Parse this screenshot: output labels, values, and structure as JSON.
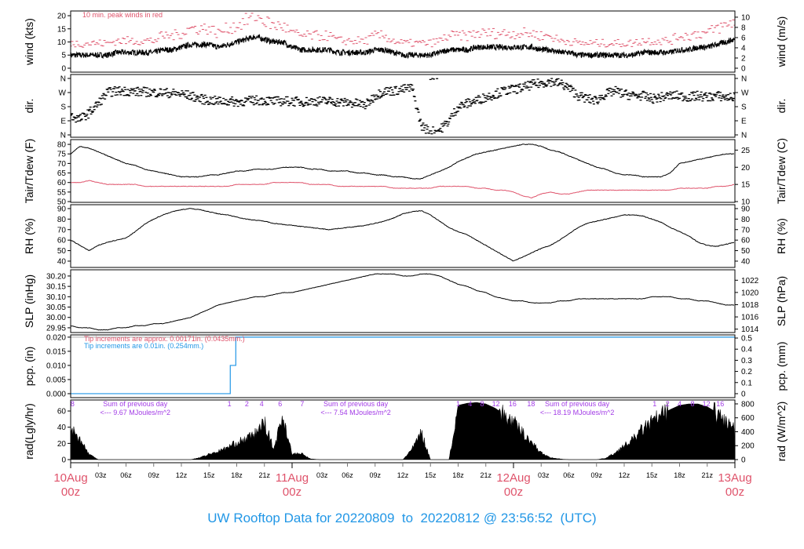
{
  "title": "UW Rooftop Data for 20220809  to  20220812 @ 23:56:52  (UTC)",
  "colors": {
    "peak": "#DF536B",
    "dew": "#DF536B",
    "pcp": "#2297E6",
    "note_red": "#DF536B",
    "note_blue": "#2297E6",
    "purple": "#A23BE6",
    "date": "#DF536B",
    "title": "#2297E6"
  },
  "x_axis": {
    "hours": [
      0,
      72
    ],
    "major": [
      {
        "hour": 0,
        "day": "10Aug",
        "time": "00z"
      },
      {
        "hour": 24,
        "day": "11Aug",
        "time": "00z"
      },
      {
        "hour": 48,
        "day": "12Aug",
        "time": "00z"
      },
      {
        "hour": 72,
        "day": "13Aug",
        "time": "00z"
      }
    ],
    "minor": [
      "03z",
      "06z",
      "09z",
      "12z",
      "15z",
      "18z",
      "21z"
    ]
  },
  "chart_data": [
    {
      "id": "wind",
      "type": "line",
      "ylabel_left": "wind (kts)",
      "ylabel_right": "wind (m/s)",
      "ylim": [
        -1.5,
        21.8
      ],
      "left_ticks": [
        {
          "label": "0",
          "value": 0
        },
        {
          "label": "5",
          "value": 5
        },
        {
          "label": "10",
          "value": 10
        },
        {
          "label": "15",
          "value": 15
        },
        {
          "label": "20",
          "value": 20
        }
      ],
      "right_ticks": [
        {
          "label": "0",
          "value": 0
        },
        {
          "label": "2",
          "value": 2
        },
        {
          "label": "4",
          "value": 4
        },
        {
          "label": "6",
          "value": 6
        },
        {
          "label": "8",
          "value": 8
        },
        {
          "label": "10",
          "value": 10
        }
      ],
      "annotation": "10 min. peak winds in red",
      "series": [
        {
          "name": "wind_mean_kts",
          "values": [
            5,
            5,
            5,
            5,
            5,
            6,
            6,
            6,
            6,
            6,
            7,
            7,
            8,
            9,
            9,
            9,
            8,
            9,
            10,
            11,
            12,
            11,
            10,
            10,
            8,
            7,
            7,
            7,
            7,
            6,
            6,
            6,
            6,
            7,
            7,
            6,
            5,
            5,
            5,
            5,
            6,
            7,
            7,
            7,
            8,
            8,
            8,
            8,
            8,
            8,
            8,
            7,
            7,
            6,
            6,
            5,
            5,
            5,
            5,
            5,
            5,
            5,
            6,
            6,
            6,
            6,
            7,
            7,
            8,
            8,
            9,
            10,
            11
          ]
        },
        {
          "name": "wind_peak_10min_kts",
          "values": [
            10,
            10,
            10,
            10,
            10,
            11,
            11,
            11,
            11,
            11,
            13,
            13,
            14,
            16,
            16,
            16,
            14,
            16,
            17,
            19,
            21,
            19,
            17,
            17,
            14,
            13,
            13,
            13,
            13,
            11,
            11,
            11,
            11,
            13,
            13,
            11,
            10,
            10,
            10,
            10,
            11,
            13,
            13,
            13,
            14,
            14,
            14,
            14,
            14,
            14,
            14,
            13,
            13,
            11,
            11,
            10,
            10,
            10,
            10,
            10,
            10,
            10,
            11,
            11,
            11,
            11,
            13,
            13,
            14,
            14,
            16,
            17,
            19
          ]
        }
      ]
    },
    {
      "id": "dir",
      "type": "scatter",
      "ylabel_left": "dir.",
      "ylabel_right": "dir.",
      "ylim": [
        -15,
        385
      ],
      "left_ticks": [
        {
          "label": "N",
          "value": 0
        },
        {
          "label": "E",
          "value": 90
        },
        {
          "label": "S",
          "value": 180
        },
        {
          "label": "W",
          "value": 270
        },
        {
          "label": "N",
          "value": 360
        }
      ],
      "right_ticks": [
        {
          "label": "N",
          "value": 0
        },
        {
          "label": "E",
          "value": 90
        },
        {
          "label": "S",
          "value": 180
        },
        {
          "label": "W",
          "value": 270
        },
        {
          "label": "N",
          "value": 360
        }
      ],
      "series": [
        {
          "name": "wind_direction_deg",
          "values": [
            120,
            100,
            140,
            200,
            270,
            280,
            280,
            275,
            275,
            270,
            270,
            265,
            260,
            250,
            230,
            220,
            215,
            215,
            210,
            215,
            220,
            220,
            215,
            215,
            215,
            210,
            215,
            215,
            215,
            210,
            205,
            200,
            190,
            250,
            280,
            280,
            290,
            300,
            60,
            20,
            30,
            90,
            180,
            200,
            220,
            240,
            260,
            280,
            290,
            300,
            320,
            330,
            340,
            330,
            300,
            250,
            230,
            220,
            260,
            280,
            260,
            250,
            250,
            230,
            240,
            250,
            250,
            240,
            250,
            240,
            250,
            240,
            240
          ]
        }
      ]
    },
    {
      "id": "temp",
      "type": "line",
      "ylabel_left": "Tair/Tdew (F)",
      "ylabel_right": "Tair/Tdew (C)",
      "ylim": [
        49.6,
        82.5
      ],
      "left_ticks": [
        {
          "label": "50",
          "value": 50
        },
        {
          "label": "55",
          "value": 55
        },
        {
          "label": "60",
          "value": 60
        },
        {
          "label": "65",
          "value": 65
        },
        {
          "label": "70",
          "value": 70
        },
        {
          "label": "75",
          "value": 75
        },
        {
          "label": "80",
          "value": 80
        }
      ],
      "right_ticks": [
        {
          "label": "10",
          "value": 10
        },
        {
          "label": "15",
          "value": 15
        },
        {
          "label": "20",
          "value": 20
        },
        {
          "label": "25",
          "value": 25
        }
      ],
      "series": [
        {
          "name": "Tair_F",
          "values": [
            75,
            79,
            78,
            76,
            74,
            72,
            70,
            69,
            67,
            66,
            65,
            64,
            63,
            63,
            63,
            64,
            64,
            65,
            66,
            66,
            67,
            67,
            67,
            68,
            68,
            68,
            67,
            67,
            66,
            66,
            66,
            65,
            65,
            64,
            64,
            63,
            63,
            62,
            62,
            64,
            66,
            68,
            71,
            73,
            75,
            76,
            77,
            78,
            79,
            80,
            80,
            79,
            77,
            76,
            74,
            72,
            70,
            68,
            67,
            65,
            64,
            64,
            63,
            63,
            63,
            65,
            70,
            71,
            72,
            73,
            74,
            75,
            75
          ]
        },
        {
          "name": "Tdew_F",
          "values": [
            60,
            60,
            61,
            60,
            59,
            59,
            59,
            59,
            58,
            58,
            58,
            58,
            58,
            58,
            58,
            58,
            58,
            58,
            59,
            59,
            59,
            59,
            60,
            60,
            60,
            60,
            59,
            59,
            59,
            58,
            58,
            58,
            58,
            58,
            58,
            57,
            57,
            57,
            57,
            57,
            58,
            58,
            58,
            58,
            57,
            57,
            56,
            56,
            55,
            53,
            52,
            54,
            55,
            54,
            54,
            55,
            56,
            56,
            56,
            56,
            56,
            56,
            56,
            56,
            56,
            56,
            57,
            57,
            57,
            57,
            58,
            58,
            59
          ]
        }
      ]
    },
    {
      "id": "rh",
      "type": "line",
      "ylabel_left": "RH (%)",
      "ylabel_right": "RH (%)",
      "ylim": [
        34,
        93.7
      ],
      "left_ticks": [
        {
          "label": "40",
          "value": 40
        },
        {
          "label": "50",
          "value": 50
        },
        {
          "label": "60",
          "value": 60
        },
        {
          "label": "70",
          "value": 70
        },
        {
          "label": "80",
          "value": 80
        },
        {
          "label": "90",
          "value": 90
        }
      ],
      "right_ticks": [
        {
          "label": "40",
          "value": 40
        },
        {
          "label": "50",
          "value": 50
        },
        {
          "label": "60",
          "value": 60
        },
        {
          "label": "70",
          "value": 70
        },
        {
          "label": "80",
          "value": 80
        },
        {
          "label": "90",
          "value": 90
        }
      ],
      "series": [
        {
          "name": "RH_pct",
          "values": [
            60,
            55,
            50,
            55,
            58,
            60,
            62,
            68,
            75,
            80,
            84,
            87,
            89,
            90,
            89,
            87,
            85,
            84,
            82,
            80,
            79,
            78,
            76,
            75,
            74,
            73,
            72,
            71,
            70,
            71,
            72,
            73,
            74,
            76,
            78,
            81,
            85,
            87,
            88,
            84,
            78,
            72,
            68,
            65,
            60,
            55,
            50,
            45,
            40,
            44,
            48,
            52,
            55,
            60,
            66,
            72,
            76,
            78,
            80,
            82,
            84,
            84,
            83,
            80,
            77,
            72,
            68,
            64,
            58,
            55,
            54,
            56,
            58
          ]
        }
      ]
    },
    {
      "id": "slp",
      "type": "line",
      "ylabel_left": "SLP (inHg)",
      "ylabel_right": "SLP (hPa)",
      "ylim": [
        29.927,
        30.23
      ],
      "left_ticks": [
        {
          "label": "29.95",
          "value": 29.95
        },
        {
          "label": "30.00",
          "value": 30.0
        },
        {
          "label": "30.05",
          "value": 30.05
        },
        {
          "label": "30.10",
          "value": 30.1
        },
        {
          "label": "30.15",
          "value": 30.15
        },
        {
          "label": "30.20",
          "value": 30.2
        }
      ],
      "right_ticks": [
        {
          "label": "1014",
          "value": 1014
        },
        {
          "label": "1016",
          "value": 1016
        },
        {
          "label": "1018",
          "value": 1018
        },
        {
          "label": "1020",
          "value": 1020
        },
        {
          "label": "1022",
          "value": 1022
        }
      ],
      "series": [
        {
          "name": "SLP_inHg",
          "values": [
            29.96,
            29.95,
            29.95,
            29.94,
            29.94,
            29.95,
            29.95,
            29.96,
            29.96,
            29.97,
            29.97,
            29.98,
            29.99,
            30.0,
            30.02,
            30.04,
            30.06,
            30.07,
            30.08,
            30.09,
            30.1,
            30.1,
            30.11,
            30.12,
            30.12,
            30.13,
            30.14,
            30.15,
            30.16,
            30.17,
            30.18,
            30.19,
            30.2,
            30.21,
            30.21,
            30.21,
            30.2,
            30.2,
            30.21,
            30.21,
            30.2,
            30.18,
            30.16,
            30.15,
            30.13,
            30.12,
            30.1,
            30.09,
            30.08,
            30.08,
            30.07,
            30.07,
            30.07,
            30.08,
            30.08,
            30.09,
            30.09,
            30.09,
            30.09,
            30.09,
            30.09,
            30.09,
            30.09,
            30.1,
            30.1,
            30.1,
            30.09,
            30.09,
            30.08,
            30.08,
            30.07,
            30.06,
            30.06
          ]
        }
      ]
    },
    {
      "id": "pcp",
      "type": "line",
      "ylabel_left": "pcp. (in)",
      "ylabel_right": "pcp. (mm)",
      "ylim": [
        -0.0014,
        0.0208
      ],
      "left_ticks": [
        {
          "label": "0.000",
          "value": 0
        },
        {
          "label": "0.005",
          "value": 0.005
        },
        {
          "label": "0.010",
          "value": 0.01
        },
        {
          "label": "0.015",
          "value": 0.015
        },
        {
          "label": "0.020",
          "value": 0.02
        }
      ],
      "right_ticks": [
        {
          "label": "0",
          "value": 0
        },
        {
          "label": "0.1",
          "value": 0.1
        },
        {
          "label": "0.2",
          "value": 0.2
        },
        {
          "label": "0.3",
          "value": 0.3
        },
        {
          "label": "0.4",
          "value": 0.4
        },
        {
          "label": "0.5",
          "value": 0.5
        }
      ],
      "note_red": "Tip increments are approx. 0.00171in. (0.0435mm.)",
      "note_blue": "Tip increments are 0.01in. (0.254mm.)",
      "series": [
        {
          "name": "accum_pcp_in",
          "x": [
            0,
            17.3,
            17.9,
            72
          ],
          "values": [
            0,
            0.01,
            0.02,
            0.02
          ]
        }
      ]
    },
    {
      "id": "rad",
      "type": "area",
      "ylabel_left": "rad(Lgly/hr)",
      "ylabel_right": "rad (W/m^2)",
      "ylim": [
        -45,
        856
      ],
      "left_ticks": [
        {
          "label": "0",
          "value": 0
        },
        {
          "label": "20",
          "value": 20
        },
        {
          "label": "40",
          "value": 40
        },
        {
          "label": "60",
          "value": 60
        }
      ],
      "right_ticks": [
        {
          "label": "0",
          "value": 0
        },
        {
          "label": "200",
          "value": 200
        },
        {
          "label": "400",
          "value": 400
        },
        {
          "label": "600",
          "value": 600
        },
        {
          "label": "800",
          "value": 800
        }
      ],
      "daily_sums": [
        {
          "label": "Sum of previous day",
          "value": "<--- 9.67 MJoules/m^2"
        },
        {
          "label": "Sum of previous day",
          "value": "<--- 7.54 MJoules/m^2"
        },
        {
          "label": "Sum of previous day",
          "value": "<--- 18.19 MJoules/m^2"
        }
      ],
      "marks": [
        "8",
        "1",
        "2",
        "4",
        "6",
        "7",
        "1",
        "4",
        "8",
        "12",
        "16",
        "18",
        "1",
        "2",
        "4",
        "8",
        "12",
        "16"
      ],
      "series": [
        {
          "name": "solar_rad_Wm2",
          "values": [
            480,
            300,
            80,
            0,
            0,
            0,
            0,
            0,
            0,
            0,
            0,
            0,
            0,
            0,
            30,
            80,
            120,
            180,
            250,
            300,
            380,
            550,
            150,
            650,
            80,
            90,
            10,
            0,
            0,
            0,
            0,
            0,
            0,
            0,
            0,
            0,
            0,
            150,
            400,
            0,
            0,
            0,
            780,
            810,
            820,
            800,
            740,
            650,
            540,
            400,
            250,
            100,
            30,
            10,
            0,
            0,
            0,
            0,
            20,
            100,
            200,
            300,
            450,
            550,
            650,
            720,
            780,
            800,
            800,
            760,
            680,
            560,
            450
          ]
        }
      ]
    }
  ]
}
